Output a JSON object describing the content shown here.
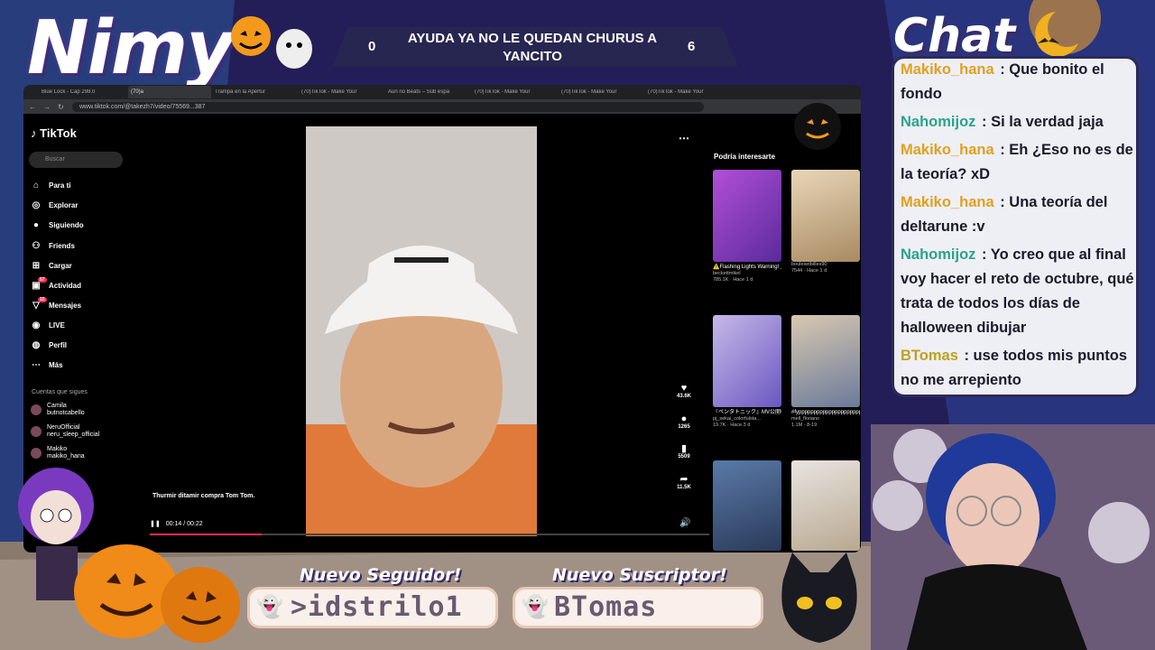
{
  "overlay": {
    "streamer_name": "Nimy",
    "chat_title": "Chat",
    "goal": {
      "text": "AYUDA YA NO LE QUEDAN CHURUS A YANCITO",
      "left_count": "0",
      "right_count": "6"
    },
    "follower_label": "Nuevo Seguidor!",
    "follower_name": ">idstrilo1",
    "subscriber_label": "Nuevo Suscriptor!",
    "subscriber_name": "BTomas"
  },
  "browser": {
    "tabs": [
      "Blue Lock - Cap 298.0",
      "(70)a",
      "Trampa en la Apertur",
      "(70)TikTok - Make Your",
      "Aun no Beats – Sub espa",
      "(70)TikTok - Make Your",
      "(70)TikTok - Make Your",
      "(70)TikTok - Make Your"
    ],
    "url": "www.tiktok.com/@takezh7/video/75569...387"
  },
  "tiktok": {
    "logo": "TikTok",
    "search_placeholder": "Buscar",
    "nav": [
      {
        "label": "Para ti",
        "icon": "home-icon"
      },
      {
        "label": "Explorar",
        "icon": "compass-icon"
      },
      {
        "label": "Siguiendo",
        "icon": "following-icon"
      },
      {
        "label": "Friends",
        "icon": "friends-icon"
      },
      {
        "label": "Cargar",
        "icon": "upload-icon"
      },
      {
        "label": "Actividad",
        "icon": "activity-icon",
        "badge": "57"
      },
      {
        "label": "Mensajes",
        "icon": "messages-icon",
        "badge": "15"
      },
      {
        "label": "LIVE",
        "icon": "live-icon"
      },
      {
        "label": "Perfil",
        "icon": "profile-icon"
      },
      {
        "label": "Más",
        "icon": "more-icon"
      }
    ],
    "following_header": "Cuentas que sigues",
    "following": [
      {
        "name": "Camila",
        "handle": "butnotcabello"
      },
      {
        "name": "NeruOfficial",
        "handle": "neru_sleep_official"
      },
      {
        "name": "Makiko",
        "handle": "makiko_hana"
      }
    ],
    "caption": "Thurmir ditamir compra Tom Tom.",
    "time": "00:14 / 00:22",
    "actions": {
      "likes": "43.6K",
      "comments": "1265",
      "saves": "5509",
      "shares": "11.5K"
    },
    "rec_title": "Podría interesarte",
    "recs": [
      {
        "title": "⚠️Flashing Lights Warning! ⚠️ ✨ 💕",
        "author": "beckettmikel",
        "views": "785.1K",
        "age": "Hace 1 d"
      },
      {
        "title": "",
        "author": "boulesetbilles90",
        "views": "7544",
        "age": "Hace 1 d"
      },
      {
        "title": "『ペンタトニック』MV公開中！#プロ...",
        "author": "pj_sekai_colorfulsta...",
        "views": "19.7K",
        "age": "Hace 3 d"
      },
      {
        "title": "#fypppppppppppppppppppppppp...",
        "author": "mell_floriano",
        "views": "1.1M",
        "age": "8-19"
      }
    ]
  },
  "chat": [
    {
      "user": "Makiko_hana",
      "color": "#e0a020",
      "text": "Que bonito el fondo"
    },
    {
      "user": "Nahomijoz",
      "color": "#2aa38a",
      "text": "Si la verdad jaja"
    },
    {
      "user": "Makiko_hana",
      "color": "#e0a020",
      "text": "Eh ¿Eso no es de la teoría? xD"
    },
    {
      "user": "Makiko_hana",
      "color": "#e0a020",
      "text": "Una teoría del deltarune :v"
    },
    {
      "user": "Nahomijoz",
      "color": "#2aa38a",
      "text": "Yo creo que al final voy hacer el reto de octubre, qué trata de todos los días de halloween dibujar"
    },
    {
      "user": "BTomas",
      "color": "#c0a020",
      "text": "use todos mis puntos no me arrepiento"
    }
  ]
}
